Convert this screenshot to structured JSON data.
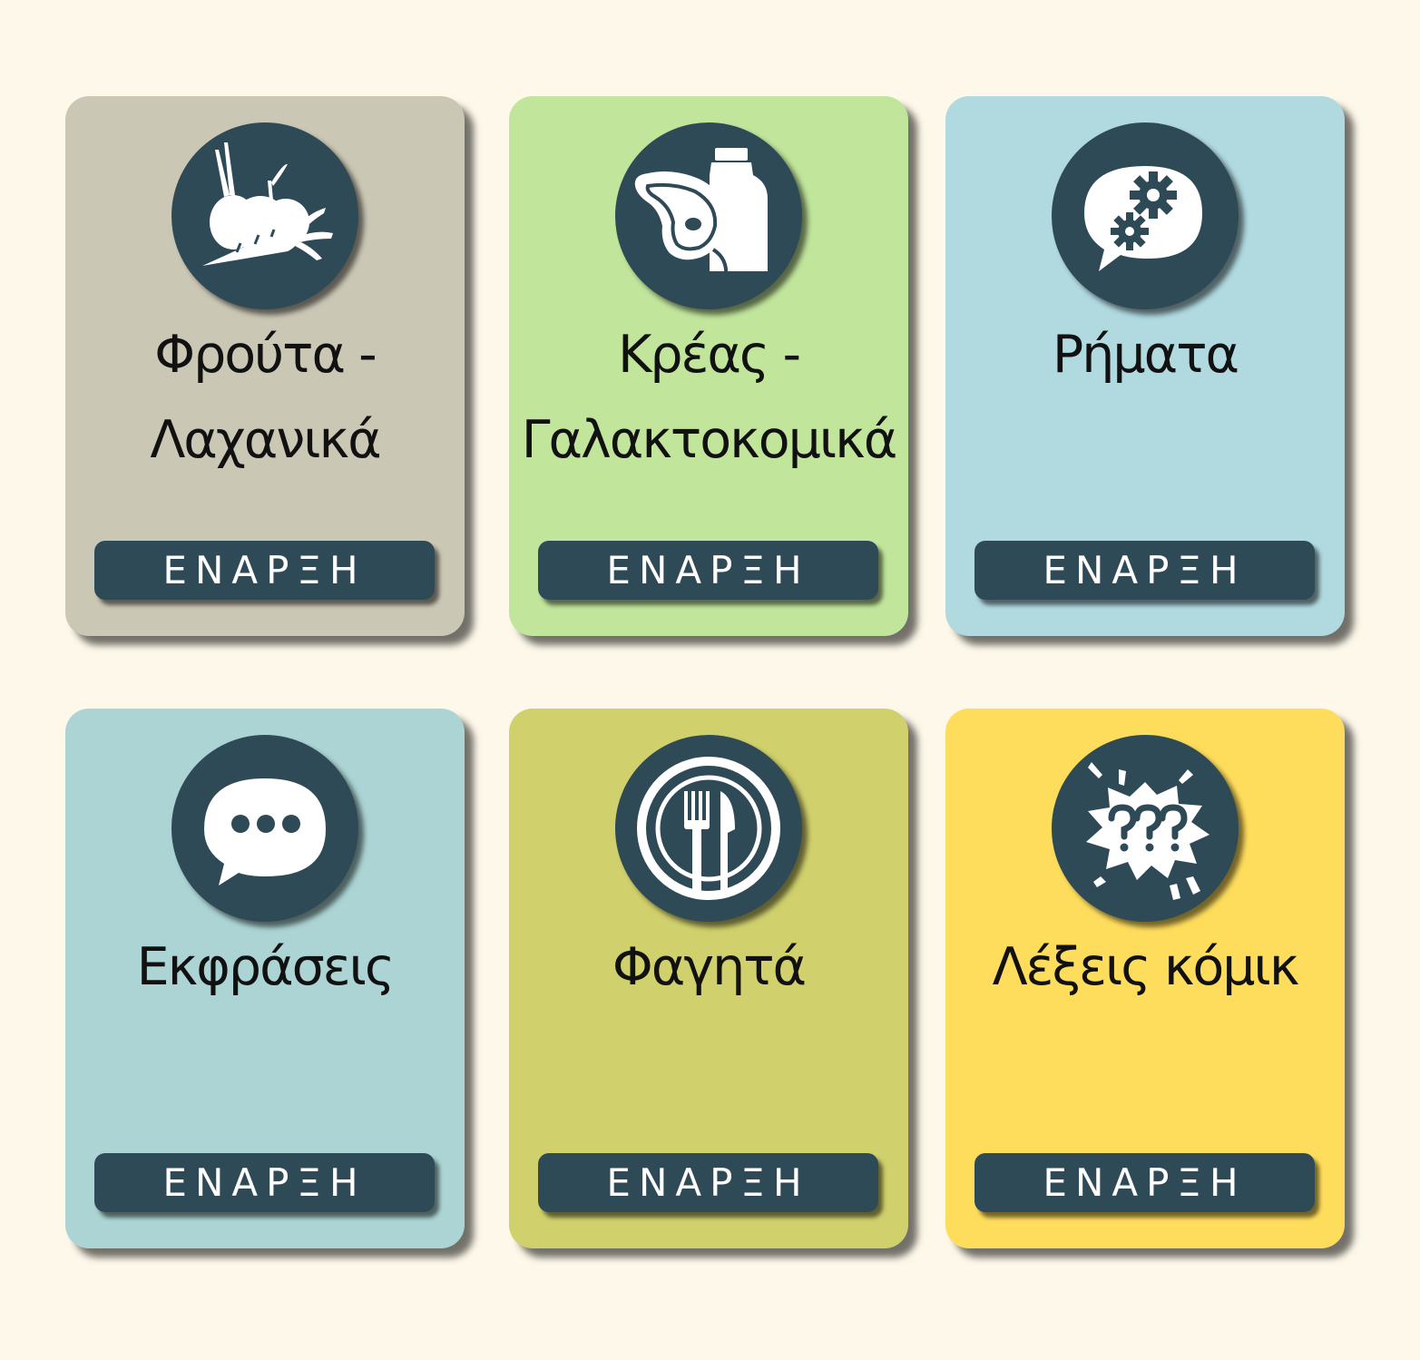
{
  "cards": [
    {
      "title": "Φρούτα - Λαχανικά",
      "button": "ΕΝΑΡΞΗ",
      "icon": "fruits-vegetables-icon",
      "color": "#cbc7b5"
    },
    {
      "title": "Κρέας - Γαλακτοκομικά",
      "button": "ΕΝΑΡΞΗ",
      "icon": "meat-dairy-icon",
      "color": "#c0e59b"
    },
    {
      "title": "Ρήματα",
      "button": "ΕΝΑΡΞΗ",
      "icon": "speech-gears-icon",
      "color": "#b0d9e0"
    },
    {
      "title": "Εκφράσεις",
      "button": "ΕΝΑΡΞΗ",
      "icon": "chat-bubble-icon",
      "color": "#acd4d4"
    },
    {
      "title": "Φαγητά",
      "button": "ΕΝΑΡΞΗ",
      "icon": "plate-fork-knife-icon",
      "color": "#d0d06c"
    },
    {
      "title": "Λέξεις κόμικ",
      "button": "ΕΝΑΡΞΗ",
      "icon": "comic-burst-icon",
      "color": "#ffdd5c"
    }
  ],
  "colors": {
    "background": "#fdf8e9",
    "icon_and_button": "#2f4a57",
    "title_text": "#111111",
    "button_text": "#ffffff"
  }
}
